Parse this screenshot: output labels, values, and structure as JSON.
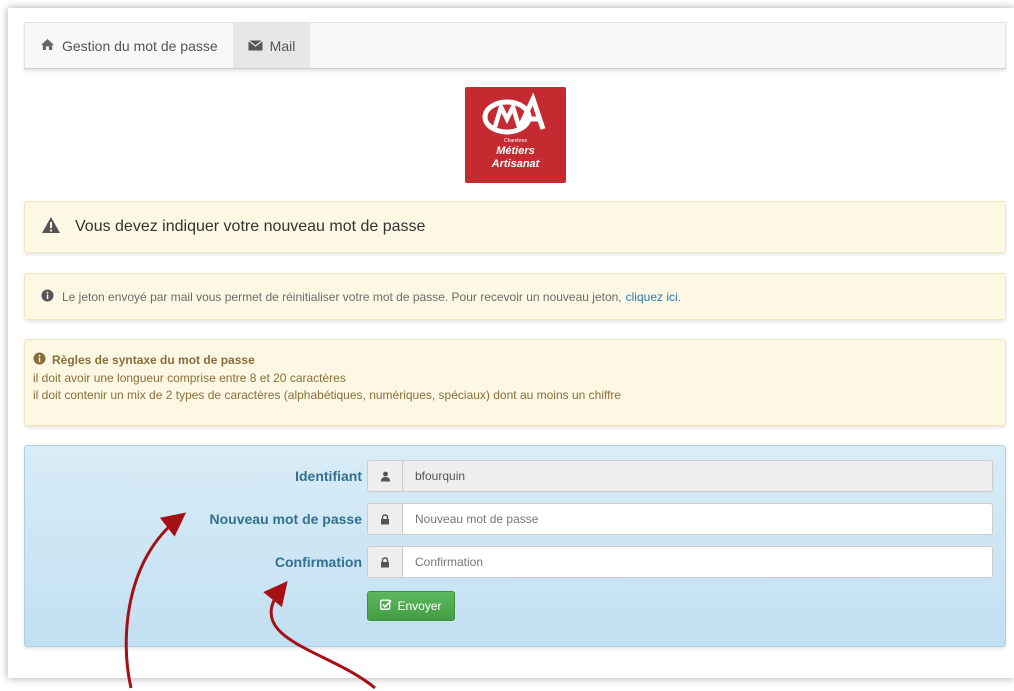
{
  "nav": {
    "items": [
      {
        "label": "Gestion du mot de passe",
        "icon": "home-icon"
      },
      {
        "label": "Mail",
        "icon": "envelope-icon"
      }
    ]
  },
  "logo": {
    "mark": "CMA",
    "line1": "Chambres",
    "line2": "Métiers",
    "line3": "Artisanat",
    "color": "#c42a30"
  },
  "alerts": {
    "warning": "Vous devez indiquer votre nouveau mot de passe",
    "info_text": "Le jeton envoyé par mail vous permet de réinitialiser votre mot de passe. Pour recevoir un nouveau jeton,",
    "info_link": "cliquez ici.",
    "rules_title": "Règles de syntaxe du mot de passe",
    "rules_line1": "il doit avoir une longueur comprise entre 8 et 20 caractères",
    "rules_line2": "il doit contenir un mix de 2 types de caractères (alphabétiques, numériques, spéciaux) dont au moins un chiffre"
  },
  "form": {
    "identifiant_label": "Identifiant",
    "identifiant_value": "bfourquin",
    "password_label": "Nouveau mot de passe",
    "password_placeholder": "Nouveau mot de passe",
    "confirm_label": "Confirmation",
    "confirm_placeholder": "Confirmation",
    "submit_label": "Envoyer"
  },
  "colors": {
    "alert_bg": "#fcf8e3",
    "panel_bg": "#c2e0f1",
    "label": "#31708f",
    "button": "#5cb85c",
    "arrow": "#a50f16",
    "link": "#2a7ab6"
  }
}
